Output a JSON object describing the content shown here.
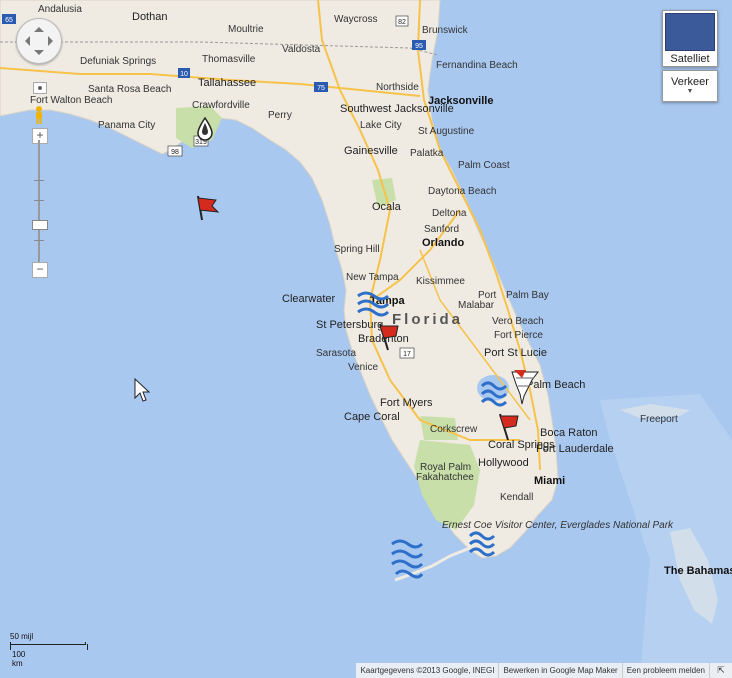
{
  "map": {
    "state_label": "Florida",
    "cities": [
      {
        "name": "Andalusia"
      },
      {
        "name": "Dothan"
      },
      {
        "name": "Moultrie"
      },
      {
        "name": "Waycross"
      },
      {
        "name": "Brunswick"
      },
      {
        "name": "Valdosta"
      },
      {
        "name": "Thomasville"
      },
      {
        "name": "Defuniak Springs"
      },
      {
        "name": "Tallahassee"
      },
      {
        "name": "Fernandina Beach"
      },
      {
        "name": "Northside"
      },
      {
        "name": "Southwest Jacksonville"
      },
      {
        "name": "Jacksonville"
      },
      {
        "name": "St Augustine"
      },
      {
        "name": "Fort Walton Beach"
      },
      {
        "name": "Santa Rosa Beach"
      },
      {
        "name": "Crawfordville"
      },
      {
        "name": "Perry"
      },
      {
        "name": "Lake City"
      },
      {
        "name": "Panama City"
      },
      {
        "name": "Gainesville"
      },
      {
        "name": "Palatka"
      },
      {
        "name": "Palm Coast"
      },
      {
        "name": "Daytona Beach"
      },
      {
        "name": "Ocala"
      },
      {
        "name": "Deltona"
      },
      {
        "name": "Sanford"
      },
      {
        "name": "Orlando"
      },
      {
        "name": "Spring Hill"
      },
      {
        "name": "New Tampa"
      },
      {
        "name": "Kissimmee"
      },
      {
        "name": "Clearwater"
      },
      {
        "name": "Tampa"
      },
      {
        "name": "Port"
      },
      {
        "name": "Palm Bay"
      },
      {
        "name": "Malabar"
      },
      {
        "name": "St Petersburg"
      },
      {
        "name": "Vero Beach"
      },
      {
        "name": "Bradenton"
      },
      {
        "name": "Fort Pierce"
      },
      {
        "name": "Sarasota"
      },
      {
        "name": "Port St Lucie"
      },
      {
        "name": "Venice"
      },
      {
        "name": "Palm Beach"
      },
      {
        "name": "Fort Myers"
      },
      {
        "name": "Cape Coral"
      },
      {
        "name": "Corkscrew"
      },
      {
        "name": "Coral Springs"
      },
      {
        "name": "Boca Raton"
      },
      {
        "name": "Fort Lauderdale"
      },
      {
        "name": "Hollywood"
      },
      {
        "name": "Miami"
      },
      {
        "name": "Royal Palm"
      },
      {
        "name": "Fakahatchee"
      },
      {
        "name": "Kendall"
      },
      {
        "name": "Ernest Coe Visitor Center, Everglades National Park"
      },
      {
        "name": "Freeport"
      },
      {
        "name": "The Bahamas"
      }
    ],
    "highway_shields": [
      "65",
      "10",
      "75",
      "95",
      "98",
      "319",
      "17",
      "82"
    ]
  },
  "controls": {
    "zoom_in": "+",
    "zoom_out": "−",
    "map_type_satellite": "Satelliet",
    "map_type_traffic": "Verkeer"
  },
  "scale": {
    "miles": "50 mijl",
    "km": "100 km"
  },
  "attribution": {
    "data": "Kaartgegevens ©2013 Google, INEGI",
    "edit": "Bewerken in Google Map Maker",
    "report": "Een probleem melden"
  },
  "colors": {
    "water": "#a9c8f0",
    "land": "#efebe2",
    "park": "#c8dfa9",
    "highway": "#f6c24a",
    "flag_red": "#d42b1e",
    "wave_blue": "#2d6fc9"
  },
  "markers": [
    {
      "icon": "drop-icon"
    },
    {
      "icon": "red-flag-icon"
    },
    {
      "icon": "waves-icon"
    },
    {
      "icon": "red-flag-icon"
    },
    {
      "icon": "waves-icon"
    },
    {
      "icon": "tornado-icon"
    },
    {
      "icon": "red-flag-icon"
    },
    {
      "icon": "waves-icon"
    },
    {
      "icon": "waves-icon"
    }
  ]
}
